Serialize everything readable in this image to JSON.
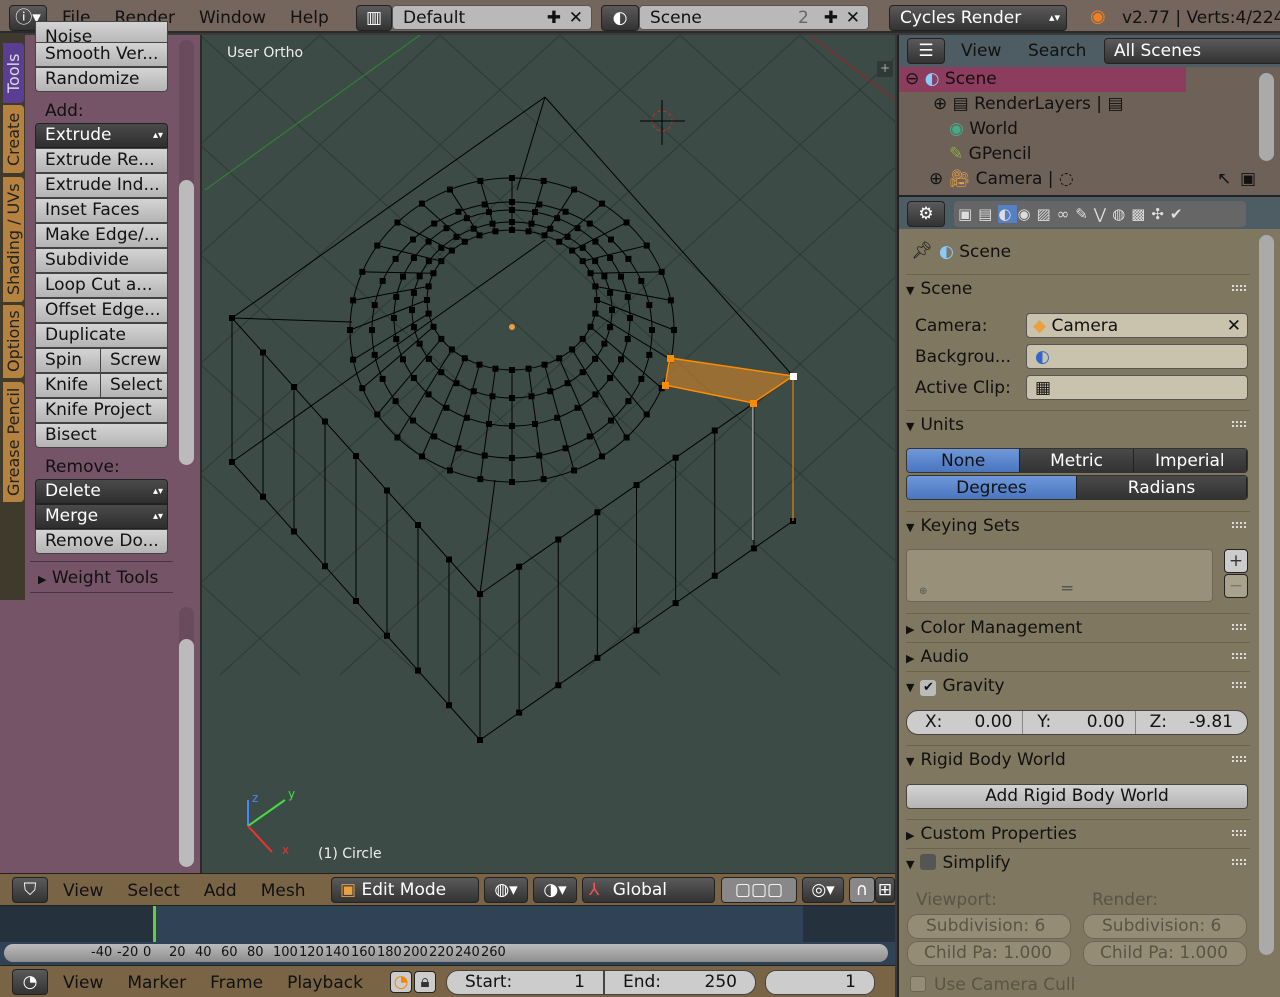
{
  "topbar": {
    "menu": [
      "File",
      "Render",
      "Window",
      "Help"
    ],
    "layout": "Default",
    "scene": "Scene",
    "scene_users": "2",
    "engine": "Cycles Render",
    "version_info": "v2.77 | Verts:4/224"
  },
  "tool_tabs": [
    "Tools",
    "Create",
    "Shading / UVs",
    "Options",
    "Grease Pencil"
  ],
  "tools": {
    "cut_item": "Noise",
    "top_items": [
      "Smooth Ver...",
      "Randomize"
    ],
    "add_label": "Add:",
    "add_dropdown": "Extrude",
    "add_items": [
      "Extrude Re...",
      "Extrude Ind...",
      "Inset Faces",
      "Make Edge/...",
      "Subdivide",
      "Loop Cut a...",
      "Offset Edge...",
      "Duplicate"
    ],
    "pairs": [
      [
        "Spin",
        "Screw"
      ],
      [
        "Knife",
        "Select"
      ]
    ],
    "add_items2": [
      "Knife Project",
      "Bisect"
    ],
    "remove_label": "Remove:",
    "remove_dropdowns": [
      "Delete",
      "Merge"
    ],
    "remove_item": "Remove Do...",
    "weight_panel": "Weight Tools"
  },
  "viewport": {
    "view_label": "User Ortho",
    "object_label": "(1) Circle",
    "axes": {
      "x": "x",
      "y": "y",
      "z": "z"
    }
  },
  "view3d_header": {
    "menu": [
      "View",
      "Select",
      "Add",
      "Mesh"
    ],
    "mode": "Edit Mode",
    "orientation": "Global"
  },
  "timeline": {
    "ticks": [
      "-40",
      "-20",
      "0",
      "20",
      "40",
      "60",
      "80",
      "100",
      "120",
      "140",
      "160",
      "180",
      "200",
      "220",
      "240",
      "260"
    ],
    "current_frame": 0
  },
  "timeline_header": {
    "menu": [
      "View",
      "Marker",
      "Frame",
      "Playback"
    ],
    "start_label": "Start:",
    "start": "1",
    "end_label": "End:",
    "end": "250",
    "frame": "1"
  },
  "outliner": {
    "menu": [
      "View",
      "Search"
    ],
    "filter": "All Scenes",
    "items": [
      {
        "label": "Scene",
        "selected": true
      },
      {
        "label": "RenderLayers"
      },
      {
        "label": "World"
      },
      {
        "label": "GPencil"
      },
      {
        "label": "Camera"
      }
    ]
  },
  "properties": {
    "context": "Scene",
    "panels": {
      "scene": {
        "title": "Scene",
        "camera_label": "Camera:",
        "camera_value": "Camera",
        "background_label": "Backgrou...",
        "clip_label": "Active Clip:"
      },
      "units": {
        "title": "Units",
        "systems": [
          "None",
          "Metric",
          "Imperial"
        ],
        "active_system": "None",
        "rotations": [
          "Degrees",
          "Radians"
        ],
        "active_rotation": "Degrees"
      },
      "keying_sets": {
        "title": "Keying Sets"
      },
      "color_management": "Color Management",
      "audio": "Audio",
      "gravity": {
        "title": "Gravity",
        "enabled": true,
        "x_label": "X:",
        "x": "0.00",
        "y_label": "Y:",
        "y": "0.00",
        "z_label": "Z:",
        "z": "-9.81"
      },
      "rigid_body": {
        "title": "Rigid Body World",
        "button": "Add Rigid Body World"
      },
      "custom_properties": "Custom Properties",
      "simplify": {
        "title": "Simplify",
        "enabled": false,
        "viewport_label": "Viewport:",
        "render_label": "Render:",
        "v_subdiv": "Subdivision:  6",
        "r_subdiv": "Subdivision:  6",
        "v_child": "Child Pa: 1.000",
        "r_child": "Child Pa: 1.000",
        "camera_cull": "Use Camera Cull"
      }
    }
  },
  "colors": {
    "selection": "#ff8c00",
    "active_tab": "#5b3e94",
    "tab": "#b5823f",
    "timeline_cursor": "#5fd03a"
  }
}
